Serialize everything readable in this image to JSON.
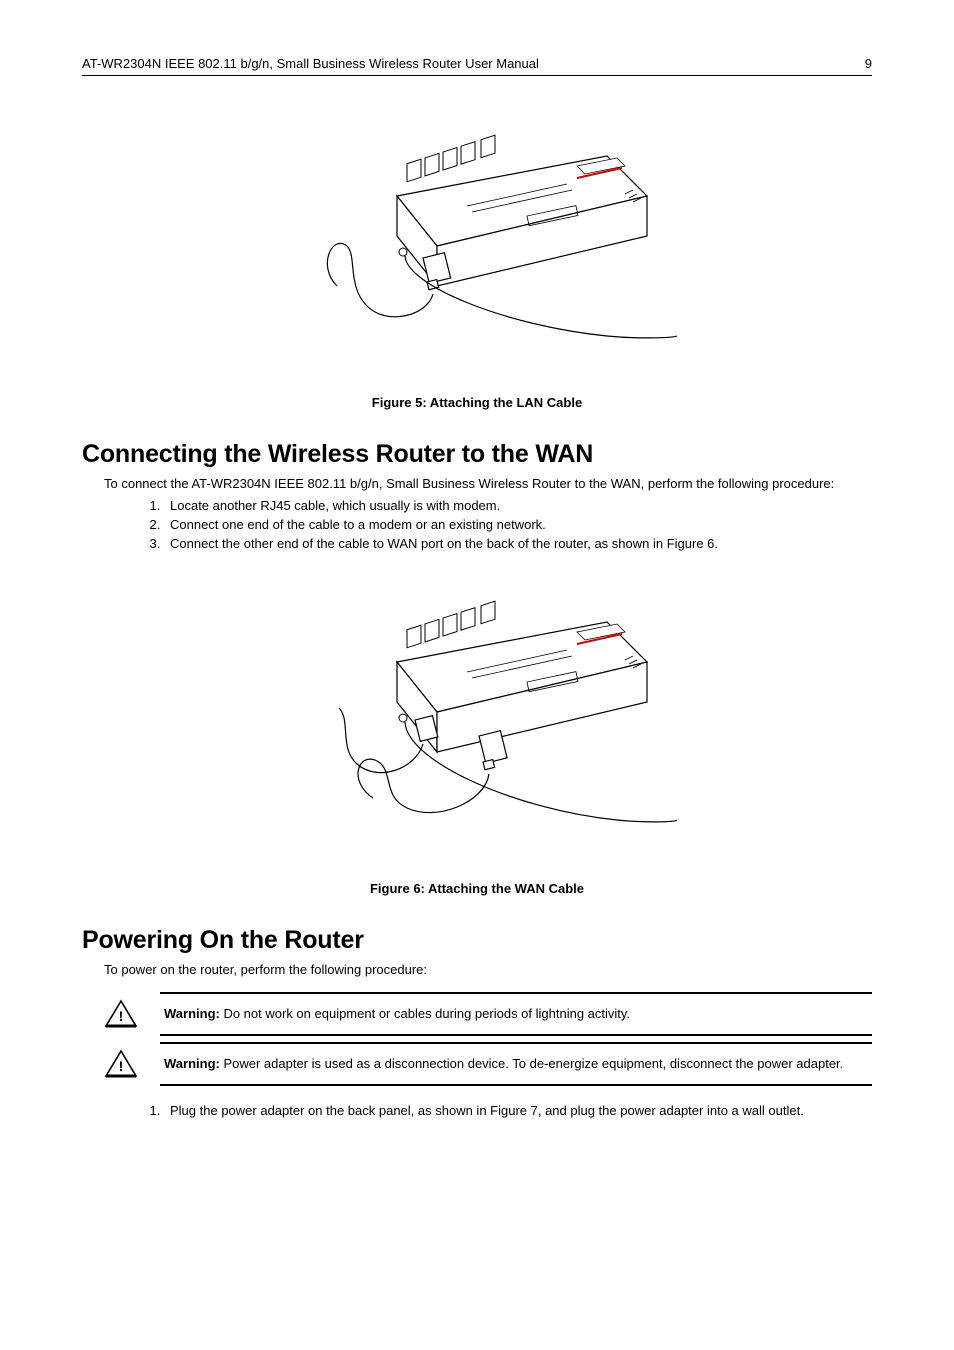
{
  "header": {
    "title": "AT-WR2304N IEEE 802.11 b/g/n, Small Business Wireless Router User Manual",
    "page_number": "9"
  },
  "figure5": {
    "caption": "Figure 5: Attaching the LAN Cable"
  },
  "section_wan": {
    "heading": "Connecting the Wireless Router to the WAN",
    "intro": "To connect the AT-WR2304N IEEE 802.11 b/g/n, Small Business Wireless Router to the WAN, perform the following procedure:",
    "steps": [
      "Locate another RJ45 cable, which usually is with modem.",
      "Connect one end of the cable to a modem or an existing network.",
      "Connect the other end of the cable to WAN port on the back of the router, as shown in Figure 6."
    ]
  },
  "figure6": {
    "caption": "Figure 6: Attaching the WAN Cable"
  },
  "section_power": {
    "heading": "Powering On the Router",
    "intro": "To power on the router, perform the following procedure:",
    "warning1_label": "Warning:",
    "warning1_text": " Do not work on equipment or cables during periods of lightning activity.",
    "warning2_label": "Warning:",
    "warning2_text": " Power adapter is used as a disconnection device. To de-energize equipment, disconnect the power adapter.",
    "steps": [
      "Plug the power adapter on the back panel, as shown in Figure 7, and plug the power adapter into a wall outlet."
    ]
  }
}
